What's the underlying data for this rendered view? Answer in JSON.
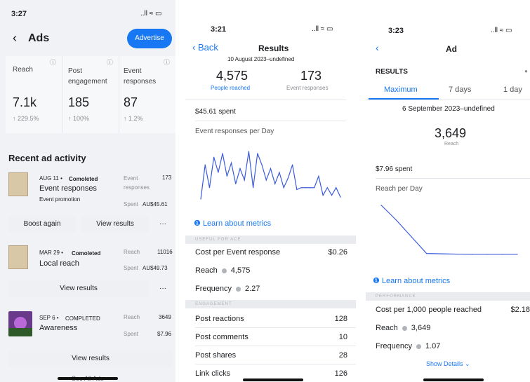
{
  "panel1": {
    "time": "3:27",
    "signal": "..ll ≈ ▭",
    "back_icon": "chevron-left-icon",
    "title": "Ads",
    "advertise_label": "Advertise",
    "metrics": [
      {
        "label": "Reach",
        "value": "7.1k",
        "change": "↑ 229.5%"
      },
      {
        "label": "Post engagement",
        "value": "185",
        "change": "↑ 100%"
      },
      {
        "label": "Event responses",
        "value": "87",
        "change": "↑ 1.2%"
      }
    ],
    "recent_title": "Recent ad activity",
    "ads": [
      {
        "date": "AUG 11 •",
        "status": "Comoleted",
        "name": "Event responses",
        "sub": "Event promotion",
        "stat1_label": "Event responses",
        "stat1_value": "173",
        "stat2_label": "Spent",
        "stat2_value": "AU$45.61",
        "btn1": "Boost again",
        "btn2": "View results",
        "more": "···"
      },
      {
        "date": "MAR 29 •",
        "status": "Comoleted",
        "name": "Local reach",
        "sub": "",
        "stat1_label": "Reach",
        "stat1_value": "11016",
        "stat2_label": "Spent",
        "stat2_value": "AU$49.73",
        "btn1": "View results",
        "more": "···"
      },
      {
        "date": "SEP 6 •",
        "status": "COMPLETED",
        "name": "Awareness",
        "sub": "",
        "stat1_label": "Reach",
        "stat1_value": "3649",
        "stat2_label": "Spent",
        "stat2_value": "$7.96",
        "btn1": "View results"
      }
    ],
    "see_all": "See All Ads"
  },
  "panel2": {
    "time": "3:21",
    "signal": "..ll ≈ ▭",
    "back_label": "Back",
    "title": "Results",
    "date_range": "10 August 2023–undefined",
    "reach_value": "4,575",
    "reach_label": "People reached",
    "event_value": "173",
    "event_label": "Event responses",
    "spent": "$45.61 spent",
    "chart_title": "Event responses per Day",
    "learn": "Learn about metrics",
    "section1": "USEFUL FOR ACE",
    "cost_label": "Cost per Event response",
    "cost_value": "$0.26",
    "reach_row_label": "Reach",
    "reach_row_value": "4,575",
    "freq_label": "Frequency",
    "freq_value": "2.27",
    "section2": "ENGAGEMENT",
    "engagement": [
      {
        "label": "Post reactions",
        "value": "128"
      },
      {
        "label": "Post comments",
        "value": "10"
      },
      {
        "label": "Post shares",
        "value": "28"
      },
      {
        "label": "Link clicks",
        "value": "126"
      }
    ]
  },
  "panel3": {
    "time": "3:23",
    "signal": "..ll ≈ ▭",
    "title": "Ad",
    "results_label": "RESULTS",
    "tabs": [
      "Maximum",
      "7 days",
      "1 day"
    ],
    "date_range": "6 September 2023–undefined",
    "reach_value": "3,649",
    "reach_label": "Reach",
    "spent": "$7.96 spent",
    "chart_title": "Reach per Day",
    "learn": "Learn about metrics",
    "section": "PERFORMANCE",
    "cost_label": "Cost per 1,000 people reached",
    "cost_value": "$2.18",
    "reach_row_label": "Reach",
    "reach_row_value": "3,649",
    "freq_label": "Frequency",
    "freq_value": "1.07",
    "show_details": "Show Details ⌄"
  },
  "colors": {
    "accent": "#1877f2",
    "line": "#3b5bdb",
    "bg_grey": "#f0f2f5"
  },
  "chart_data": [
    {
      "type": "line",
      "title": "Event responses per Day",
      "values": [
        0,
        0.9,
        0.3,
        1.1,
        0.7,
        1.2,
        0.6,
        0.95,
        0.4,
        0.8,
        0.5,
        1.25,
        0.3,
        1.2,
        0.9,
        0.5,
        0.8,
        0.4,
        0.7,
        0.3,
        0.55,
        0.9,
        0.25,
        0.3,
        0.3,
        0.3,
        0.3,
        0.6,
        0.1,
        0.3,
        0.1,
        0.3,
        0.05
      ]
    },
    {
      "type": "line",
      "title": "Reach per Day",
      "values": [
        3.0,
        2.1,
        1.1,
        0.1,
        0.08,
        0.06,
        0.05,
        0.05,
        0.05,
        0.05
      ]
    }
  ]
}
